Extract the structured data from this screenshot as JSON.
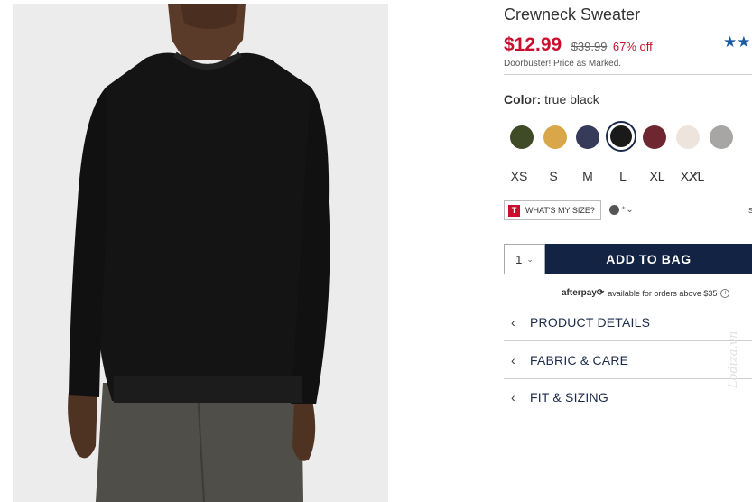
{
  "product": {
    "title": "Crewneck Sweater",
    "rating_stars": "★★",
    "price": {
      "sale": "$12.99",
      "original": "$39.99",
      "discount": "67% off",
      "note": "Doorbuster! Price as Marked."
    }
  },
  "color": {
    "label": "Color:",
    "selected": "true black",
    "swatches": [
      {
        "name": "olive",
        "hex": "#3f4a26"
      },
      {
        "name": "mustard",
        "hex": "#d9a74a"
      },
      {
        "name": "navy",
        "hex": "#363b5a"
      },
      {
        "name": "true black",
        "hex": "#1a1a1a",
        "selected": true
      },
      {
        "name": "burgundy",
        "hex": "#6e2630"
      },
      {
        "name": "cream",
        "hex": "#ede5dd"
      },
      {
        "name": "heather gray",
        "hex": "#a8a6a4"
      }
    ]
  },
  "sizes": [
    {
      "label": "XS"
    },
    {
      "label": "S"
    },
    {
      "label": "M"
    },
    {
      "label": "L"
    },
    {
      "label": "XL"
    },
    {
      "label": "XXL",
      "out_of_stock": true
    }
  ],
  "fit": {
    "button_label": "WHAT'S MY SIZE?",
    "logo_letter": "T",
    "profile_caret": "⁺⌄",
    "cut_text": "s"
  },
  "cart": {
    "quantity": "1",
    "add_label": "ADD TO BAG"
  },
  "afterpay": {
    "brand": "afterpay⟳",
    "text": "available for orders above $35",
    "info": "i"
  },
  "accordion": [
    {
      "label": "PRODUCT DETAILS"
    },
    {
      "label": "FABRIC & CARE"
    },
    {
      "label": "FIT & SIZING"
    }
  ],
  "watermark": "Lodiza.vn"
}
